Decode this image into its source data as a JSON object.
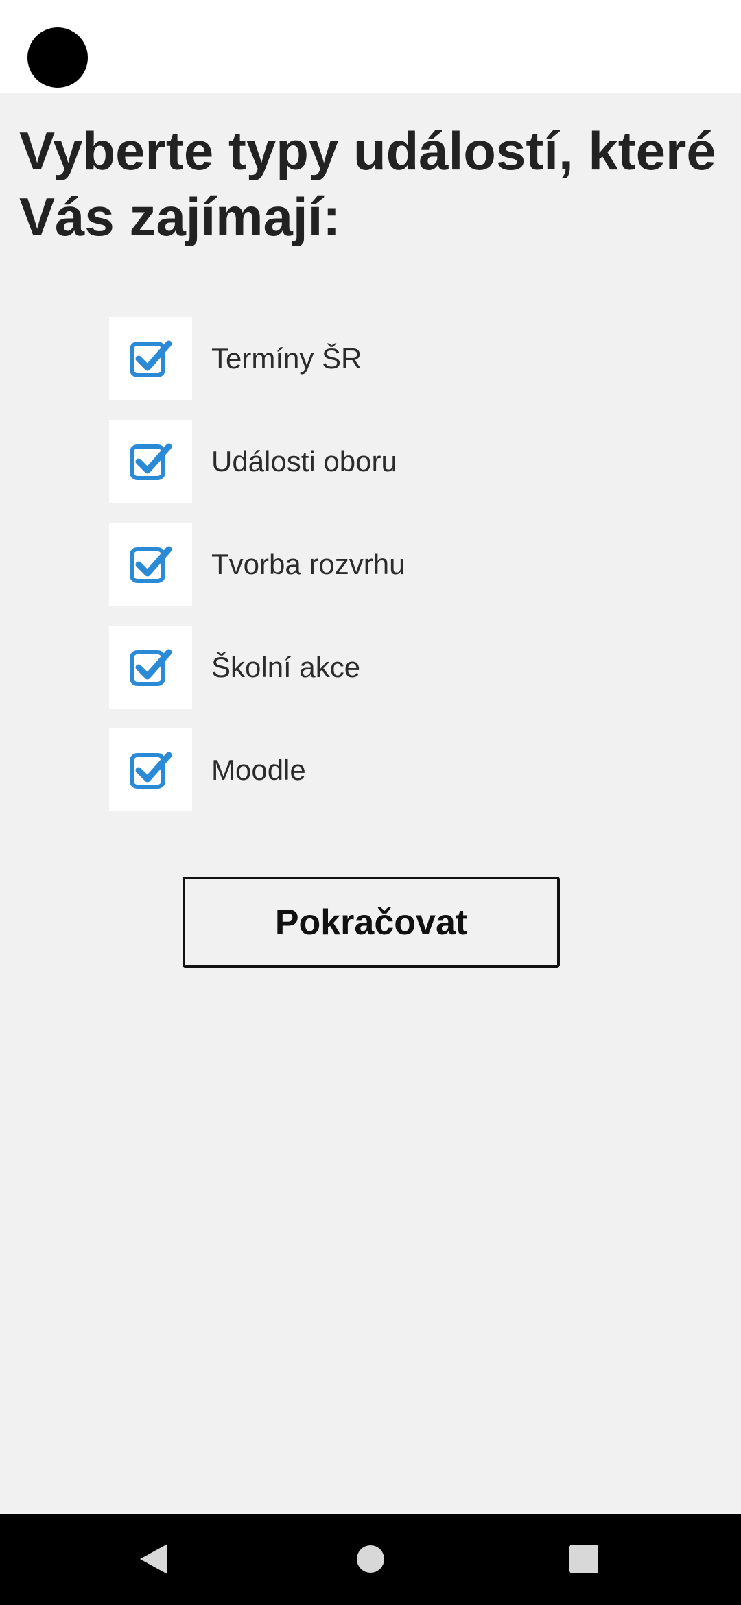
{
  "page": {
    "title": "Vyberte typy událostí, které Vás zajímají:"
  },
  "options": [
    {
      "label": "Termíny ŠR",
      "checked": true
    },
    {
      "label": "Události oboru",
      "checked": true
    },
    {
      "label": "Tvorba rozvrhu",
      "checked": true
    },
    {
      "label": "Školní akce",
      "checked": true
    },
    {
      "label": "Moodle",
      "checked": true
    }
  ],
  "continue_button": {
    "label": "Pokračovat"
  },
  "colors": {
    "background": "#f1f1f1",
    "checkbox_accent": "#2a8ad6",
    "text": "#222222"
  },
  "icons": {
    "checkbox": "checkbox-checked-icon",
    "nav_back": "back-triangle-icon",
    "nav_home": "home-circle-icon",
    "nav_recents": "recents-square-icon"
  }
}
